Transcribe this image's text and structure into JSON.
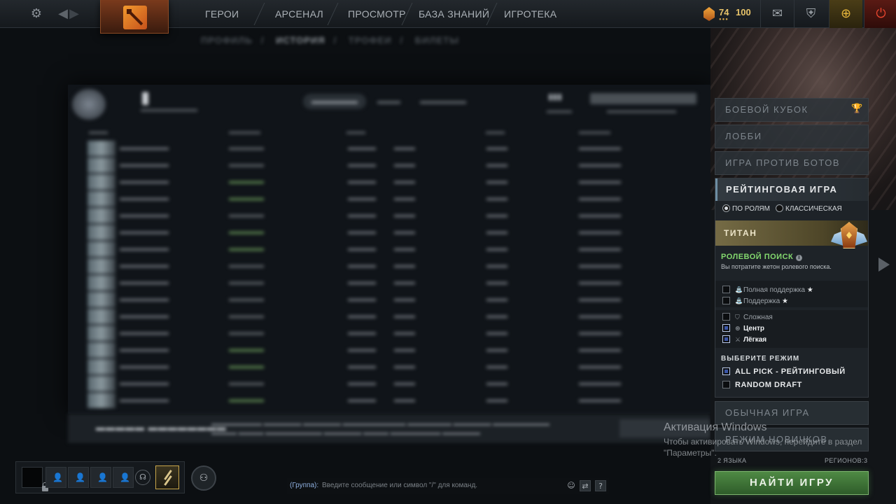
{
  "topbar": {
    "nav": [
      "ГЕРОИ",
      "АРСЕНАЛ",
      "ПРОСМОТР",
      "БАЗА ЗНАНИЙ",
      "ИГРОТЕКА"
    ],
    "currency": {
      "shards": "74",
      "coins": "100"
    },
    "icons": [
      "gear-icon",
      "back-arrow-icon",
      "forward-arrow-icon",
      "dota-logo",
      "mail-icon",
      "armory-icon",
      "dota-plus-icon",
      "power-icon"
    ]
  },
  "profile": {
    "subnav": [
      "ПРОФИЛЬ",
      "ИСТОРИЯ",
      "ТРОФЕИ",
      "БИЛЕТЫ"
    ],
    "active_subnav": "ИСТОРИЯ"
  },
  "right_panel": {
    "modes": [
      {
        "label": "БОЕВОЙ КУБОК",
        "icon": "trophy-icon"
      },
      {
        "label": "ЛОББИ"
      },
      {
        "label": "ИГРА ПРОТИВ БОТОВ"
      }
    ],
    "ranked": {
      "title": "РЕЙТИНГОВАЯ ИГРА",
      "radio_roles": "ПО РОЛЯМ",
      "radio_classic": "КЛАССИЧЕСКАЯ",
      "selected": "roles",
      "rank_name": "ТИТАН",
      "role_search_title": "РОЛЕВОЙ ПОИСК",
      "role_search_sub": "Вы потратите жетон ролевого поиска.",
      "roles": [
        {
          "label": "Полная поддержка",
          "checked": false,
          "star": true
        },
        {
          "label": "Поддержка",
          "checked": false,
          "star": true
        },
        {
          "label": "Сложная",
          "checked": false,
          "star": false
        },
        {
          "label": "Центр",
          "checked": true,
          "star": false
        },
        {
          "label": "Лёгкая",
          "checked": true,
          "star": false
        }
      ],
      "select_mode_title": "ВЫБЕРИТЕ РЕЖИМ",
      "game_modes": [
        {
          "label": "ALL PICK - РЕЙТИНГОВЫЙ",
          "checked": true
        },
        {
          "label": "RANDOM DRAFT",
          "checked": false
        }
      ]
    },
    "normal": "ОБЫЧНАЯ ИГРА",
    "newbie": "РЕЖИМ НОВИЧКОВ",
    "languages": "2 ЯЗЫКА",
    "regions": "РЕГИОНОВ:3",
    "find_button": "НАЙТИ ИГРУ"
  },
  "watermark": {
    "title": "Активация Windows",
    "text": "Чтобы активировать Windows, перейдите в раздел \"Параметры\"."
  },
  "chat": {
    "channel": "(Группа):",
    "placeholder": "Введите сообщение или символ \"/\" для команд.",
    "help": "?"
  },
  "colors": {
    "accent_green": "#4f8a44",
    "role_search_green": "#83d86e",
    "rank_gold": "#756b45"
  }
}
